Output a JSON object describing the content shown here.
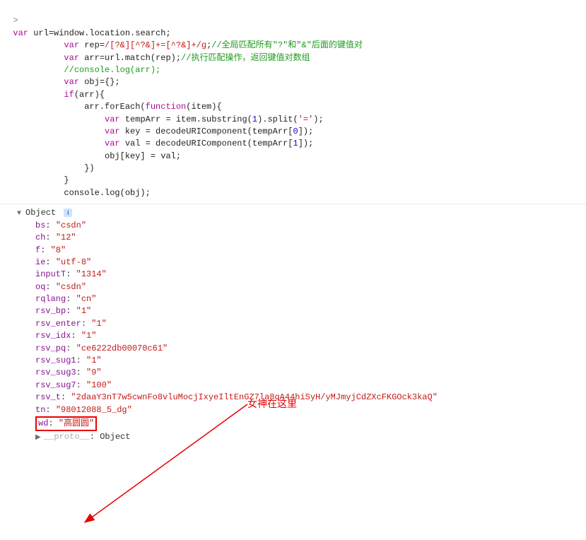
{
  "code": {
    "l1": "var url=window.location.search;",
    "l2a": "var rep=",
    "l2regex": "/[?&][^?&]+=[^?&]+/g",
    "l2b": ";",
    "l2cmt": "//全局匹配所有\"?\"和\"&\"后面的键值对",
    "l3a": "var arr=url.match(rep);",
    "l3cmt": "//执行匹配操作，返回键值对数组",
    "l4": "//console.log(arr);",
    "l5": "var obj={};",
    "l6": "if(arr){",
    "l7": "    arr.forEach(function(item){",
    "l8": "        var tempArr = item.substring(1).split('=');",
    "l9": "        var key = decodeURIComponent(tempArr[0]);",
    "l10": "        var val = decodeURIComponent(tempArr[1]);",
    "l11": "        obj[key] = val;",
    "l12": "    })",
    "l13": "}",
    "l14": "console.log(obj);"
  },
  "obj_label": "Object",
  "info_glyph": "i",
  "twisty_down": "▼",
  "twisty_right": "▶",
  "props": [
    {
      "k": "bs",
      "v": "\"csdn\""
    },
    {
      "k": "ch",
      "v": "\"12\""
    },
    {
      "k": "f",
      "v": "\"8\""
    },
    {
      "k": "ie",
      "v": "\"utf-8\""
    },
    {
      "k": "inputT",
      "v": "\"1314\""
    },
    {
      "k": "oq",
      "v": "\"csdn\""
    },
    {
      "k": "rqlang",
      "v": "\"cn\""
    },
    {
      "k": "rsv_bp",
      "v": "\"1\""
    },
    {
      "k": "rsv_enter",
      "v": "\"1\""
    },
    {
      "k": "rsv_idx",
      "v": "\"1\""
    },
    {
      "k": "rsv_pq",
      "v": "\"ce6222db00070c61\""
    },
    {
      "k": "rsv_sug1",
      "v": "\"1\""
    },
    {
      "k": "rsv_sug3",
      "v": "\"9\""
    },
    {
      "k": "rsv_sug7",
      "v": "\"100\""
    },
    {
      "k": "rsv_t",
      "v": "\"2daaY3nT7w5cwnFo8vluMocjIxyeIltEnGZ7la8qA44hiSyH/yMJmyjCdZXcFKGOck3kaQ\""
    },
    {
      "k": "tn",
      "v": "\"98012088_5_dg\""
    }
  ],
  "highlight": {
    "k": "wd",
    "v": "\"高圆圆\""
  },
  "proto": {
    "k": "__proto__",
    "v": "Object"
  },
  "annotation": "女神在这里",
  "prompt_glyph": ">"
}
